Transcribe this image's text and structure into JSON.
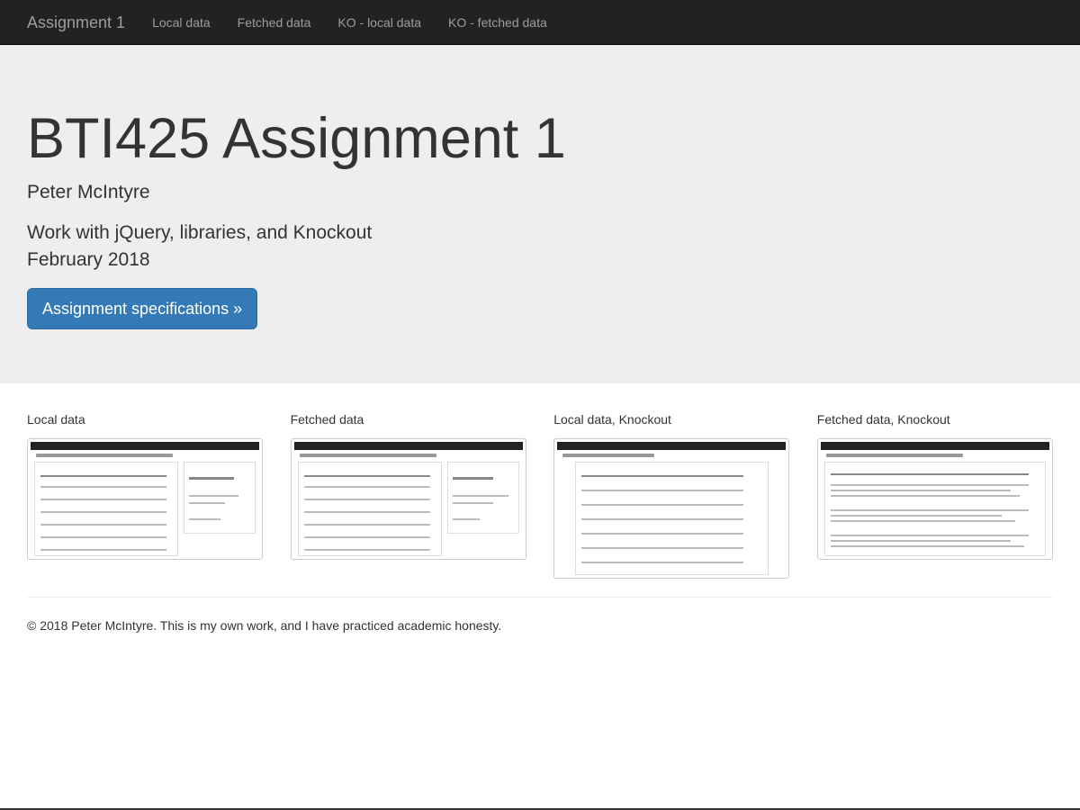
{
  "navbar": {
    "brand": "Assignment 1",
    "links": [
      "Local data",
      "Fetched data",
      "KO - local data",
      "KO - fetched data"
    ]
  },
  "jumbotron": {
    "title": "BTI425 Assignment 1",
    "author": "Peter McIntyre",
    "description": "Work with jQuery, libraries, and Knockout",
    "date": "February 2018",
    "button_label": "Assignment specifications »"
  },
  "thumbnails": [
    {
      "title": "Local data"
    },
    {
      "title": "Fetched data"
    },
    {
      "title": "Local data, Knockout"
    },
    {
      "title": "Fetched data, Knockout"
    }
  ],
  "footer": {
    "text": "© 2018 Peter McIntyre. This is my own work, and I have practiced academic honesty."
  },
  "colors": {
    "navbar_bg": "#222222",
    "jumbotron_bg": "#eeeeee",
    "primary": "#337ab7"
  }
}
